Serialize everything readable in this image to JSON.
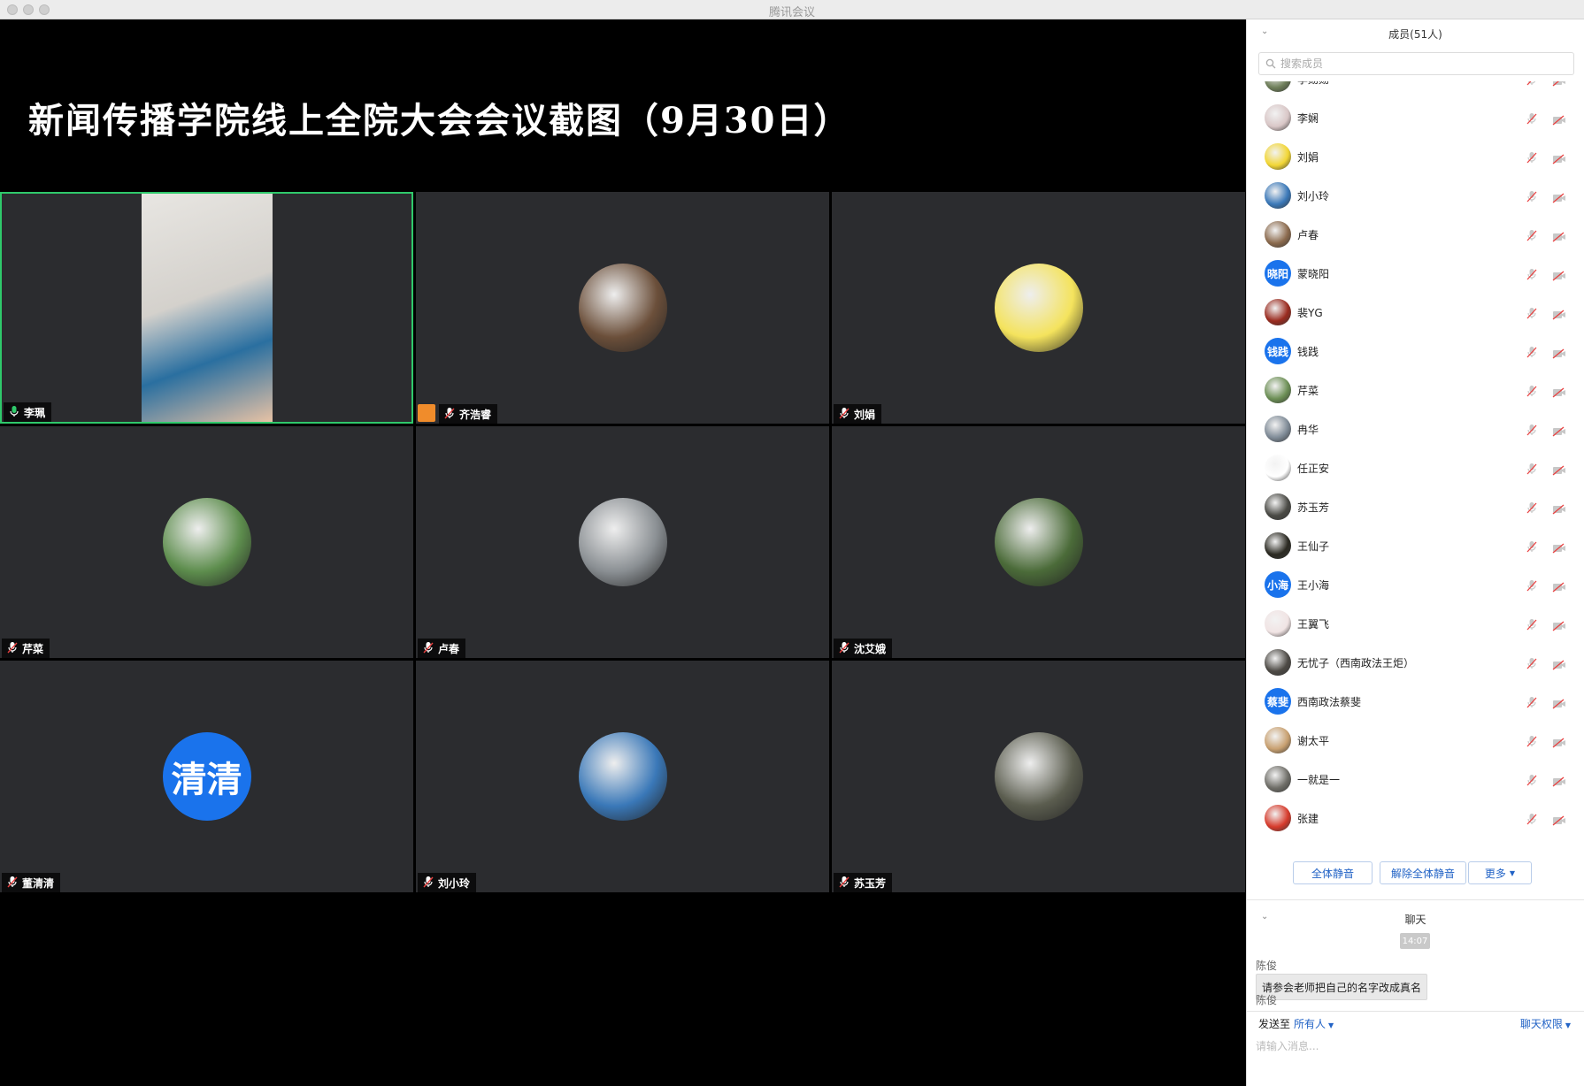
{
  "window": {
    "title": "腾讯会议"
  },
  "banner": {
    "text": "新闻传播学院线上全院大会会议截图（9月30日）"
  },
  "tiles": [
    {
      "name": "李珮",
      "avatar_text": "",
      "bg": "#2b2c2f"
    },
    {
      "name": "齐浩睿",
      "avatar_text": "",
      "bg": "#6b4f3a"
    },
    {
      "name": "刘娟",
      "avatar_text": "",
      "bg": "#f4e35d"
    },
    {
      "name": "芹菜",
      "avatar_text": "",
      "bg": "#5d8d4d"
    },
    {
      "name": "卢春",
      "avatar_text": "",
      "bg": "#8a8f93"
    },
    {
      "name": "沈艾娥",
      "avatar_text": "",
      "bg": "#4b6b39"
    },
    {
      "name": "董清清",
      "avatar_text": "清清",
      "bg": "#1a73ec"
    },
    {
      "name": "刘小玲",
      "avatar_text": "",
      "bg": "#3a78b8"
    },
    {
      "name": "苏玉芳",
      "avatar_text": "",
      "bg": "#5b5d4f"
    }
  ],
  "members": {
    "title": "成员(51人)",
    "search_placeholder": "搜索成员",
    "items": [
      {
        "name": "李勋勋",
        "avatar_text": "",
        "color": "#6f7f5a"
      },
      {
        "name": "李娴",
        "avatar_text": "",
        "color": "#d9c7c7"
      },
      {
        "name": "刘娟",
        "avatar_text": "",
        "color": "#f2d635"
      },
      {
        "name": "刘小玲",
        "avatar_text": "",
        "color": "#3a78b8"
      },
      {
        "name": "卢春",
        "avatar_text": "",
        "color": "#8b6a4d"
      },
      {
        "name": "蒙晓阳",
        "avatar_text": "晓阳",
        "color": "#1a73ec"
      },
      {
        "name": "裴YG",
        "avatar_text": "",
        "color": "#9a2b1f"
      },
      {
        "name": "钱践",
        "avatar_text": "钱践",
        "color": "#1a73ec"
      },
      {
        "name": "芹菜",
        "avatar_text": "",
        "color": "#6c8f55"
      },
      {
        "name": "冉华",
        "avatar_text": "",
        "color": "#7e8a96"
      },
      {
        "name": "任正安",
        "avatar_text": "",
        "color": "#ffffff"
      },
      {
        "name": "苏玉芳",
        "avatar_text": "",
        "color": "#4a4a45"
      },
      {
        "name": "王仙子",
        "avatar_text": "",
        "color": "#2b2a22"
      },
      {
        "name": "王小海",
        "avatar_text": "小海",
        "color": "#1a73ec"
      },
      {
        "name": "王翼飞",
        "avatar_text": "",
        "color": "#f1e4e4"
      },
      {
        "name": "无忧子（西南政法王炬）",
        "avatar_text": "",
        "color": "#4d4a45"
      },
      {
        "name": "西南政法蔡斐",
        "avatar_text": "蔡斐",
        "color": "#1a73ec"
      },
      {
        "name": "谢太平",
        "avatar_text": "",
        "color": "#c8a070"
      },
      {
        "name": "一就是一",
        "avatar_text": "",
        "color": "#6f6e68"
      },
      {
        "name": "张建",
        "avatar_text": "",
        "color": "#d63b2c"
      }
    ],
    "buttons": {
      "mute_all": "全体静音",
      "unmute_all": "解除全体静音",
      "more": "更多"
    }
  },
  "chat": {
    "title": "聊天",
    "time": "14:07",
    "messages": [
      {
        "sender": "陈俊",
        "text": "请参会老师把自己的名字改成真名"
      },
      {
        "sender": "陈俊",
        "text": ""
      }
    ],
    "send_to_label": "发送至",
    "send_target": "所有人",
    "permission": "聊天权限",
    "input_placeholder": "请输入消息..."
  }
}
